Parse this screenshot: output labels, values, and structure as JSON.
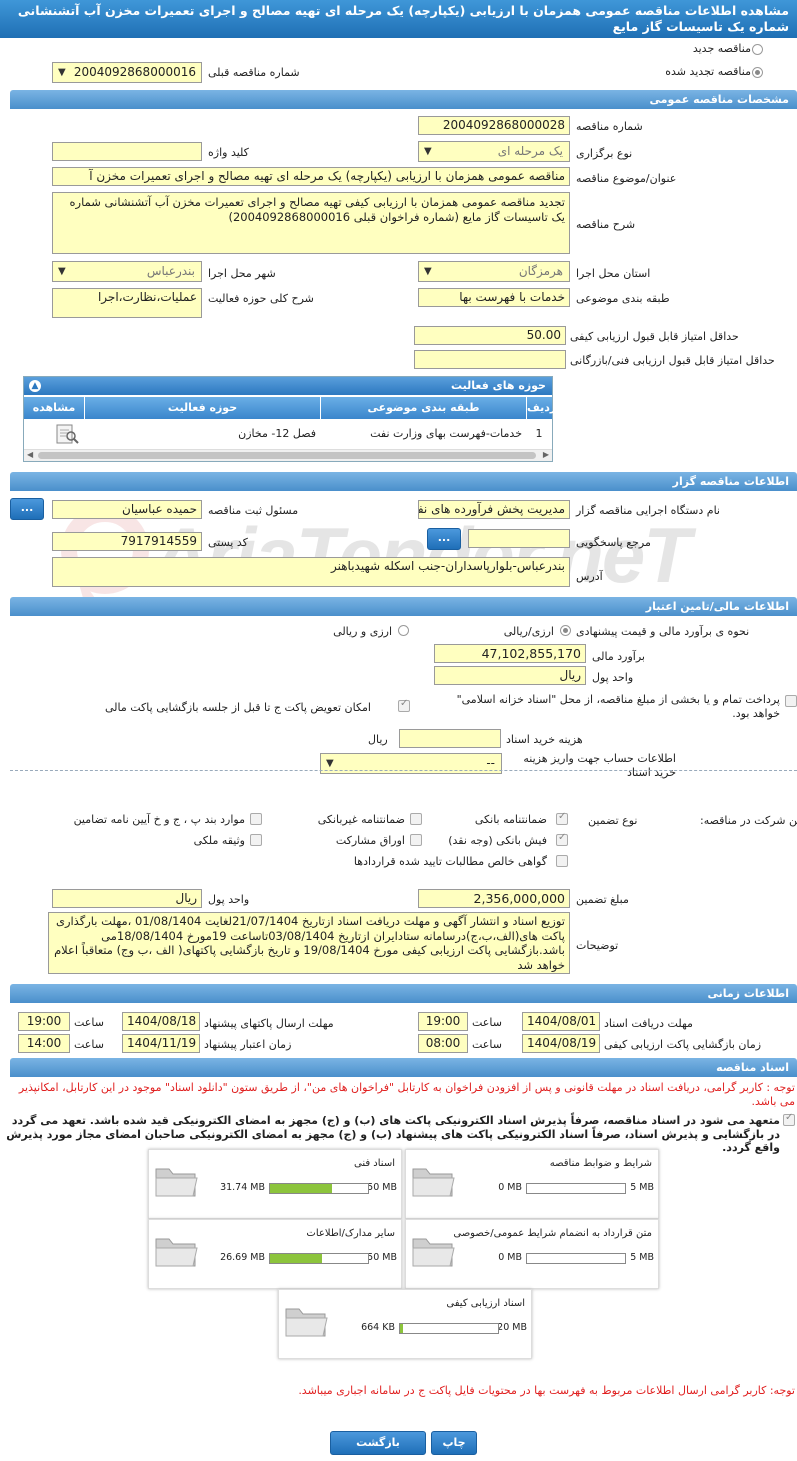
{
  "header": {
    "title": "مشاهده اطلاعات مناقصه عمومی همزمان با ارزیابی (یکپارچه) یک مرحله ای تهیه مصالح و اجرای تعمیرات مخزن آب آتشنشانی شماره یک تاسیسات گاز مایع"
  },
  "tender_type": {
    "new_label": "مناقصه جدید",
    "renewed_label": "مناقصه تجدید شده",
    "prev_number_label": "شماره مناقصه قبلی",
    "prev_number_value": "2004092868000016"
  },
  "general": {
    "section_title": "مشخصات مناقصه عمومی",
    "number_label": "شماره مناقصه",
    "number_value": "2004092868000028",
    "holding_type_label": "نوع برگزاری",
    "holding_type_value": "یک مرحله ای",
    "keyword_label": "کلید واژه",
    "keyword_value": "",
    "subject_label": "عنوان/موضوع مناقصه",
    "subject_value": "مناقصه عمومی همزمان با ارزیابی (یکپارچه) یک مرحله ای تهیه مصالح و اجرای تعمیرات مخزن آ",
    "description_label": "شرح مناقصه",
    "description_value": "تجدید مناقصه عمومی همزمان با ارزیابی کیفی تهیه مصالح و اجرای تعمیرات مخزن آب آتشنشانی شماره یک تاسیسات گاز مایع (شماره فراخوان قبلی 2004092868000016)",
    "province_label": "استان محل اجرا",
    "province_value": "هرمزگان",
    "city_label": "شهر محل اجرا",
    "city_value": "بندرعباس",
    "category_label": "طبقه بندی موضوعی",
    "category_value": "خدمات با فهرست بها",
    "scope_label": "شرح کلی حوزه فعالیت",
    "scope_value": "عملیات،نظارت،اجرا",
    "min_quality_label": "حداقل امتیاز قابل قبول ارزیابی کیفی",
    "min_quality_value": "50.00",
    "min_tech_label": "حداقل امتیاز قابل قبول ارزیابی فنی/بازرگانی",
    "min_tech_value": ""
  },
  "activity_grid": {
    "title": "حوزه های فعالیت",
    "col_row": "ردیف",
    "col_category": "طبقه بندی موضوعی",
    "col_field": "حوزه فعالیت",
    "col_view": "مشاهده",
    "rows": [
      {
        "row": "1",
        "category": "خدمات-فهرست بهای وزارت نفت",
        "field": "فصل 12- مخازن"
      }
    ]
  },
  "organizer": {
    "section_title": "اطلاعات مناقصه گزار",
    "org_label": "نام دستگاه اجرایی مناقصه گزار",
    "org_value": "مدیریت پخش فرآورده های نفتی",
    "registrar_label": "مسئول ثبت مناقصه",
    "registrar_value": "حمیده عباسیان",
    "responder_label": "مرجع پاسخگویی",
    "responder_value": "",
    "postal_label": "کد پستی",
    "postal_value": "7917914559",
    "address_label": "آدرس",
    "address_value": "بندرعباس-بلوارپاسداران-جنب اسکله شهیدباهنر",
    "more_button": "..."
  },
  "financial": {
    "section_title": "اطلاعات مالی/تامین اعتبار",
    "estimate_method_label": "نحوه ی برآورد مالی و قیمت پیشنهادی",
    "opt_currency": "ارزی/ریالی",
    "opt_currency_and_rial": "ارزی و ریالی",
    "estimate_label": "برآورد مالی",
    "estimate_value": "47,102,855,170",
    "currency_label": "واحد پول",
    "currency_value": "ریال",
    "treasury_label": "پرداخت تمام و یا بخشی از مبلغ مناقصه، از محل \"اسناد خزانه اسلامی\" خواهد بود.",
    "swap_label": "امکان تعویض پاکت ج تا قبل از جلسه بازگشایی پاکت مالی",
    "doc_cost_label": "هزینه خرید اسناد",
    "doc_cost_value": "",
    "doc_cost_unit": "ریال",
    "account_label": "اطلاعات حساب جهت واریز هزینه خرید اسناد",
    "account_value": "--"
  },
  "guarantee": {
    "title": "تضمین شرکت در مناقصه:",
    "type_label": "نوع تضمین",
    "opt_bank": "ضمانتنامه بانکی",
    "opt_nonbank": "ضمانتنامه غیربانکی",
    "opt_items": "موارد بند پ ، ج و خ آیین نامه تضامین",
    "opt_cash": "فیش بانکی (وجه نقد)",
    "opt_bonds": "اوراق مشارکت",
    "opt_property": "وثیقه ملکی",
    "opt_receivables": "گواهی خالص مطالبات تایید شده قراردادها",
    "amount_label": "مبلغ تضمین",
    "amount_value": "2,356,000,000",
    "unit_label": "واحد پول",
    "unit_value": "ریال",
    "notes_label": "توضیحات",
    "notes_value": "توزیع اسناد و انتشار آگهی و مهلت دریافت اسناد ازتاریخ 21/07/1404لغایت 01/08/1404 ،مهلت بارگذاری پاکت های(الف،ب،ج)درسامانه ستادایران ازتاریخ 03/08/1404تاساعت 19مورخ 18/08/1404می باشد.بازگشایی پاکت ارزیابی کیفی مورخ 19/08/1404 و تاریخ بازگشایی پاکتهای( الف ،ب وج) متعاقباً اعلام خواهد شد"
  },
  "timing": {
    "section_title": "اطلاعات زمانی",
    "doc_deadline_label": "مهلت دریافت اسناد",
    "doc_deadline_date": "1404/08/01",
    "doc_deadline_time": "19:00",
    "submit_deadline_label": "مهلت ارسال پاکتهای پیشنهاد",
    "submit_deadline_date": "1404/08/18",
    "submit_deadline_time": "19:00",
    "quality_open_label": "زمان بازگشایی پاکت ارزیابی کیفی",
    "quality_open_date": "1404/08/19",
    "quality_open_time": "08:00",
    "validity_label": "زمان اعتبار پیشنهاد",
    "validity_date": "1404/11/19",
    "validity_time": "14:00",
    "time_label": "ساعت"
  },
  "documents": {
    "section_title": "اسناد مناقصه",
    "note1": "توجه : کاربر گرامی، دریافت اسناد در مهلت قانونی و پس از افزودن فراخوان به کارتابل \"فراخوان های من\"، از طریق ستون \"دانلود اسناد\" موجود در این کارتابل، امکانپذیر می باشد.",
    "commitment": "متعهد می شود در اسناد مناقصه، صرفاً پذیرش اسناد الکترونیکی پاکت های (ب) و (ج) مجهز به امضای الکترونیکی قید شده باشد. تعهد می گردد در بازگشایی و پذیرش اسناد، صرفاً اسناد الکترونیکی پاکت های پیشنهاد (ب) و (ج) مجهز به امضای الکترونیکی صاحبان امضای مجاز مورد پذیرش واقع گردد.",
    "files": [
      {
        "name": "شرایط و ضوابط مناقصه",
        "size": "0 MB",
        "max": "5 MB",
        "ratio": 0
      },
      {
        "name": "اسناد فنی",
        "size": "31.74 MB",
        "max": "50 MB",
        "ratio": 0.635
      },
      {
        "name": "متن قرارداد به انضمام شرایط عمومی/خصوصی",
        "size": "0 MB",
        "max": "5 MB",
        "ratio": 0
      },
      {
        "name": "سایر مدارک/اطلاعات",
        "size": "26.69 MB",
        "max": "50 MB",
        "ratio": 0.534
      },
      {
        "name": "اسناد ارزیابی کیفی",
        "size": "664 KB",
        "max": "20 MB",
        "ratio": 0.032
      }
    ],
    "note2": "توجه: کاربر گرامی ارسال اطلاعات مربوط به فهرست بها در محتویات فایل پاکت ج در سامانه اجباری میباشد."
  },
  "footer": {
    "back_button": "بازگشت",
    "print_button": "چاپ"
  },
  "watermark": "AriaTender.neT"
}
